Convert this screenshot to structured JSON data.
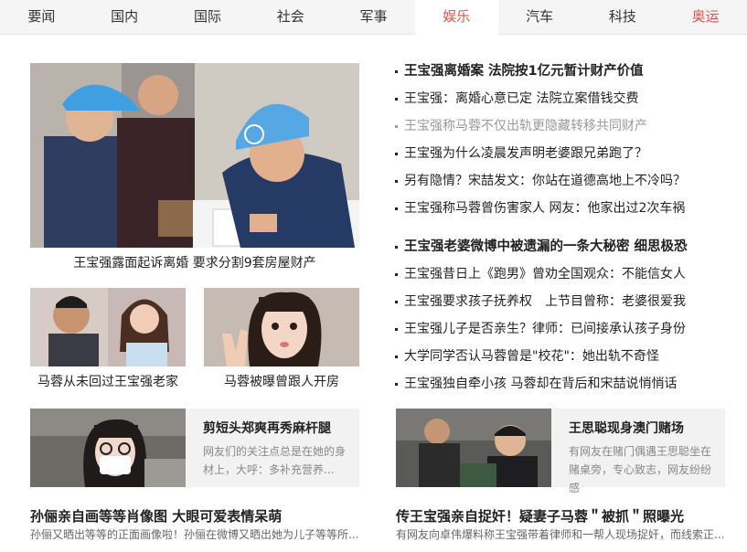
{
  "nav": {
    "items": [
      {
        "label": "要闻",
        "state": ""
      },
      {
        "label": "国内",
        "state": ""
      },
      {
        "label": "国际",
        "state": ""
      },
      {
        "label": "社会",
        "state": ""
      },
      {
        "label": "军事",
        "state": ""
      },
      {
        "label": "娱乐",
        "state": "active"
      },
      {
        "label": "汽车",
        "state": ""
      },
      {
        "label": "科技",
        "state": ""
      },
      {
        "label": "奥运",
        "state": "hot"
      }
    ],
    "accent_color": "#e25149"
  },
  "hero": {
    "caption": "王宝强露面起诉离婚 要求分割9套房屋财产"
  },
  "thumbs": [
    {
      "caption": "马蓉从未回过王宝强老家"
    },
    {
      "caption": "马蓉被曝曾跟人开房"
    }
  ],
  "features": [
    {
      "title": "剪短头郑爽再秀麻杆腿",
      "desc": "网友们的关注点总是在她的身材上，大呼：多补充营养..."
    },
    {
      "title": "王思聪现身澳门赌场",
      "desc": "有网友在赌门偶遇王思聪坐在赌桌旁，专心致志，网友纷纷感"
    }
  ],
  "bottom": [
    {
      "title": "孙俪亲自画等等肖像图 大眼可爱表情呆萌",
      "desc": "孙俪又晒出等等的正面画像啦！孙俪在微博又晒出她为儿子等等所..."
    },
    {
      "title": "传王宝强亲自捉奸！疑妻子马蓉＂被抓＂照曝光",
      "desc": "有网友向卓伟爆料称王宝强带着律师和一帮人现场捉奸，而线索正..."
    }
  ],
  "news_group_1": [
    {
      "text": "王宝强离婚案 法院按1亿元暂计财产价值",
      "style": "bold"
    },
    {
      "text": "王宝强：离婚心意已定 法院立案借钱交费",
      "style": ""
    },
    {
      "text": "王宝强称马蓉不仅出轨更隐藏转移共同财产",
      "style": "gray"
    },
    {
      "text": "王宝强为什么凌晨发声明老婆跟兄弟跑了？",
      "style": ""
    },
    {
      "text": "另有隐情？宋喆发文：你站在道德高地上不冷吗？",
      "style": ""
    },
    {
      "text": "王宝强称马蓉曾伤害家人 网友：他家出过2次车祸",
      "style": ""
    }
  ],
  "news_group_2": [
    {
      "text": "王宝强老婆微博中被遗漏的一条大秘密 细思极恐",
      "style": "bold"
    },
    {
      "text": "王宝强昔日上《跑男》曾劝全国观众：不能信女人",
      "style": ""
    },
    {
      "text": "王宝强要求孩子抚养权　上节目曾称：老婆很爱我",
      "style": ""
    },
    {
      "text": "王宝强儿子是否亲生？律师：已间接承认孩子身份",
      "style": ""
    },
    {
      "text": "大学同学否认马蓉曾是\"校花\"：她出轨不奇怪",
      "style": ""
    },
    {
      "text": "王宝强独自牵小孩 马蓉却在背后和宋喆说悄悄话",
      "style": ""
    }
  ]
}
